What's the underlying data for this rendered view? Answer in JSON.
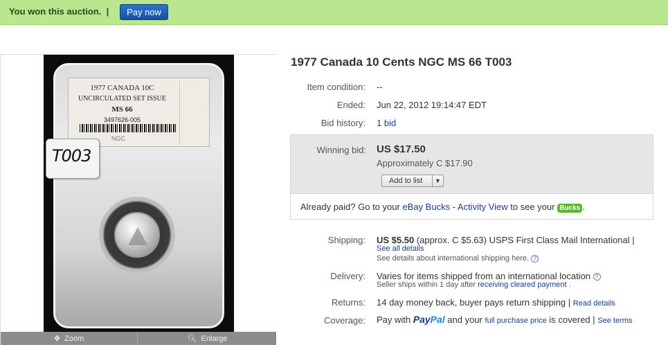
{
  "banner": {
    "message": "You won this auction.",
    "separator": "|",
    "pay_label": "Pay now"
  },
  "gallery": {
    "slab_line1": "1977 CANADA 10C",
    "slab_line2": "UNCIRCULATED SET ISSUE",
    "slab_grade": "MS 66",
    "slab_cert": "3497626-005",
    "slab_brand": "NGC",
    "tag_text": "T003",
    "zoom_label": "Zoom",
    "enlarge_label": "Enlarge"
  },
  "item": {
    "title": "1977 Canada 10 Cents NGC MS 66 T003",
    "condition_label": "Item condition:",
    "condition_value": "--",
    "ended_label": "Ended:",
    "ended_value": "Jun 22, 2012 19:14:47 EDT",
    "bid_history_label": "Bid history:",
    "bid_history_value": "1 bid",
    "winning_bid_label": "Winning bid:",
    "winning_bid_value": "US $17.50",
    "approx_value": "Approximately C $17.90",
    "add_to_list_label": "Add to list"
  },
  "paid": {
    "prefix": "Already paid? Go to your ",
    "link": "eBay Bucks - Activity View",
    "suffix": " to see your ",
    "badge": "Bucks",
    "end": "."
  },
  "shipping": {
    "label": "Shipping:",
    "price": "US $5.50",
    "detail": " (approx. C $5.63) USPS First Class Mail International  |",
    "see_all": "See all details",
    "intl_note": "See details about international shipping here."
  },
  "delivery": {
    "label": "Delivery:",
    "text": "Varies for items shipped from an international location",
    "note_prefix": "Seller ships within 1 day after ",
    "note_link": "receiving cleared payment",
    "note_suffix": " ."
  },
  "returns": {
    "label": "Returns:",
    "text": "14 day money back, buyer pays return shipping | ",
    "link": "Read details"
  },
  "coverage": {
    "label": "Coverage:",
    "prefix": "Pay with ",
    "paypal_a": "Pay",
    "paypal_b": "Pal",
    "mid": " and your ",
    "link1": "full purchase price",
    "mid2": " is covered | ",
    "link2": "See terms"
  },
  "colors": {
    "banner": "#b9e68e",
    "pay_button": "#1f5fb5",
    "link": "#1a3d8f",
    "bucks_badge": "#5bb531"
  }
}
